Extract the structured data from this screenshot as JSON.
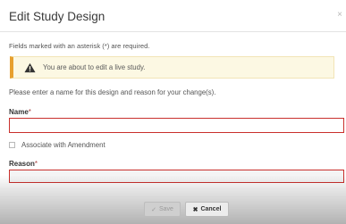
{
  "modal": {
    "title": "Edit Study Design",
    "close_glyph": "×"
  },
  "required_note": "Fields marked with an asterisk (*) are required.",
  "warning": {
    "icon": "warning-triangle-icon",
    "color": "#e7a02f",
    "text": "You are about to edit a live study."
  },
  "instruction": "Please enter a name for this design and reason for your change(s).",
  "fields": {
    "name": {
      "label": "Name",
      "required_mark": "*",
      "value": ""
    },
    "associate_amendment": {
      "label": "Associate with Amendment",
      "checked": false
    },
    "reason": {
      "label": "Reason",
      "required_mark": "*",
      "value": ""
    }
  },
  "buttons": {
    "save": {
      "glyph": "✓",
      "label": "Save",
      "enabled": false
    },
    "cancel": {
      "glyph": "✖",
      "label": "Cancel"
    }
  },
  "colors": {
    "error_border": "#c9302c",
    "warning_bg": "#fcf8e3"
  }
}
